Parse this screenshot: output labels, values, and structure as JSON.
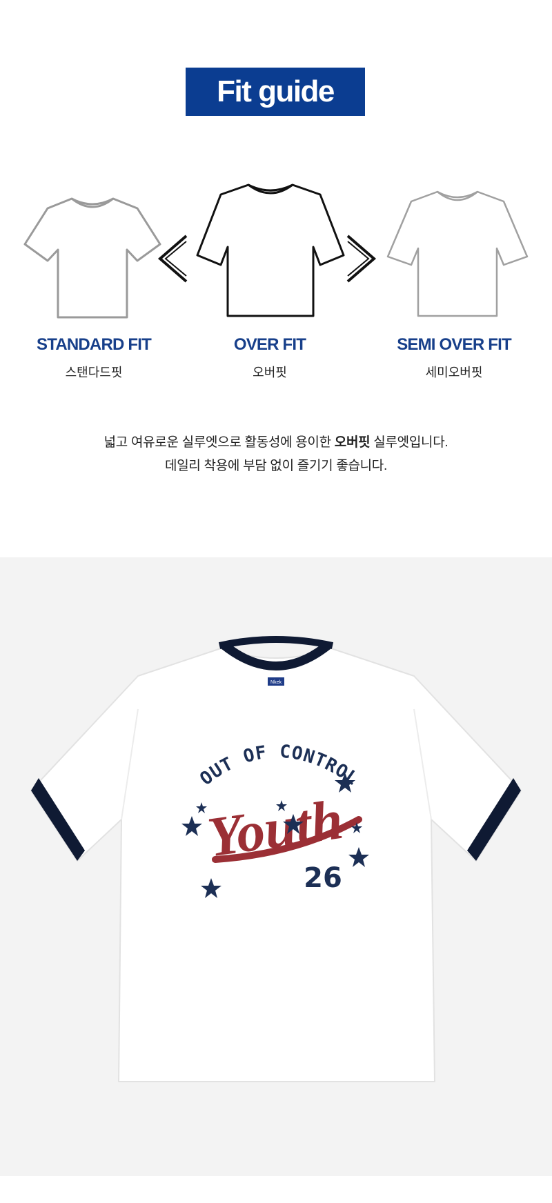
{
  "fit_guide": {
    "title": "Fit guide",
    "fits": [
      {
        "label": "STANDARD FIT",
        "sub": "스탠다드핏"
      },
      {
        "label": "OVER FIT",
        "sub": "오버핏"
      },
      {
        "label": "SEMI OVER FIT",
        "sub": "세미오버핏"
      }
    ],
    "arrows": [
      "<",
      ">"
    ]
  },
  "description": {
    "line1_before": "넓고 여유로운 실루엣으로 활동성에 용이한 ",
    "line1_bold": "오버핏",
    "line1_after": " 실루엣입니다.",
    "line2": "데일리 착용에 부담 없이 즐기기 좋습니다."
  },
  "product": {
    "neck_tag": "Nkek",
    "graphic": {
      "arc_text": "OUT OF CONTROL",
      "script_text": "Youth",
      "number": "26"
    },
    "colors": {
      "trim": "#0f1a33",
      "script": "#9b2f35",
      "navy": "#1c2f55",
      "body": "#ffffff",
      "background": "#f3f3f3"
    }
  }
}
